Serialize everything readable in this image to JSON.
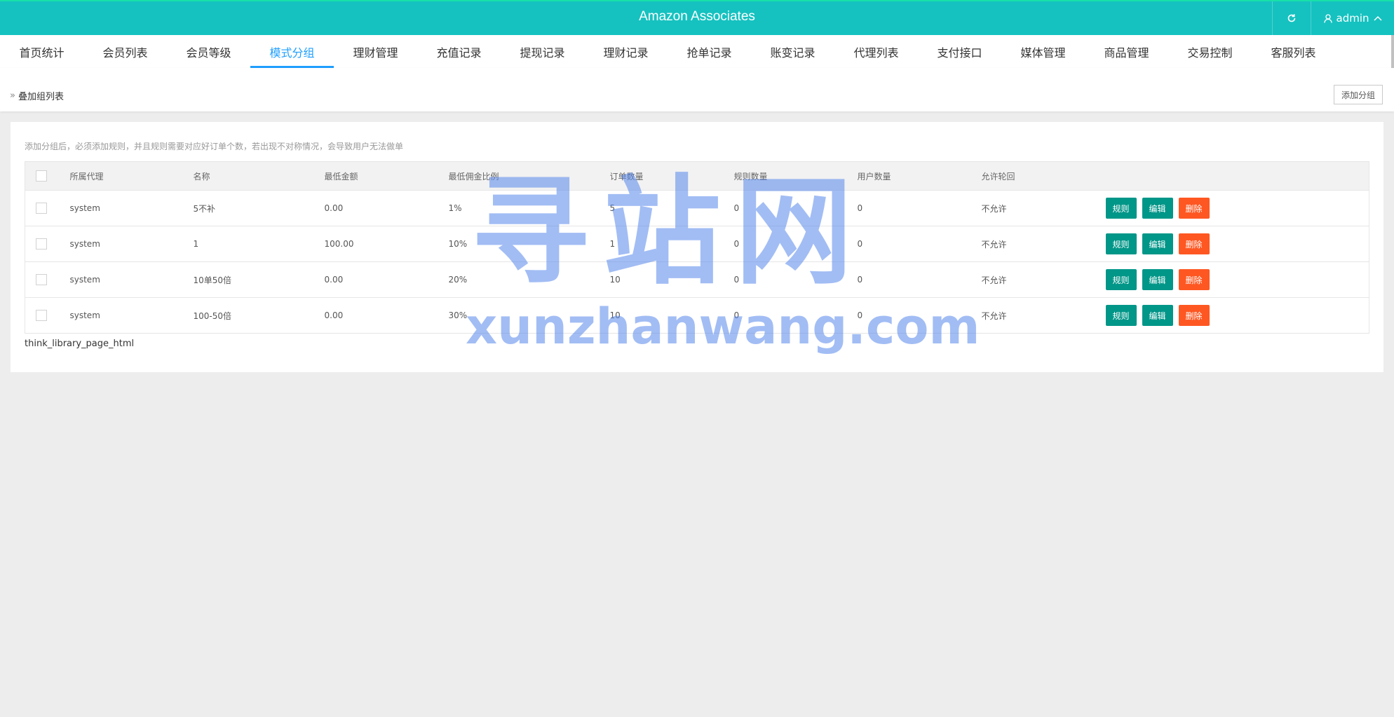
{
  "header": {
    "title": "Amazon Associates",
    "user_label": "admin"
  },
  "nav": {
    "tabs": [
      {
        "label": "首页统计"
      },
      {
        "label": "会员列表"
      },
      {
        "label": "会员等级"
      },
      {
        "label": "模式分组",
        "active": true
      },
      {
        "label": "理财管理"
      },
      {
        "label": "充值记录"
      },
      {
        "label": "提现记录"
      },
      {
        "label": "理财记录"
      },
      {
        "label": "抢单记录"
      },
      {
        "label": "账变记录"
      },
      {
        "label": "代理列表"
      },
      {
        "label": "支付接口"
      },
      {
        "label": "媒体管理"
      },
      {
        "label": "商品管理"
      },
      {
        "label": "交易控制"
      },
      {
        "label": "客服列表"
      }
    ]
  },
  "breadcrumb": {
    "label": "叠加组列表",
    "add_button": "添加分组"
  },
  "content": {
    "notice": "添加分组后，必须添加规则，并且规则需要对应好订单个数，若出现不对称情况，会导致用户无法做单",
    "table": {
      "headers": [
        "所属代理",
        "名称",
        "最低金额",
        "最低佣金比例",
        "订单数量",
        "规则数量",
        "用户数量",
        "允许轮回"
      ],
      "rows": [
        {
          "agent": "system",
          "name": "5不补",
          "min_amount": "0.00",
          "min_ratio": "1%",
          "orders": "5",
          "rules": "0",
          "users": "0",
          "allow": "不允许"
        },
        {
          "agent": "system",
          "name": "1",
          "min_amount": "100.00",
          "min_ratio": "10%",
          "orders": "1",
          "rules": "0",
          "users": "0",
          "allow": "不允许"
        },
        {
          "agent": "system",
          "name": "10单50倍",
          "min_amount": "0.00",
          "min_ratio": "20%",
          "orders": "10",
          "rules": "0",
          "users": "0",
          "allow": "不允许"
        },
        {
          "agent": "system",
          "name": "100-50倍",
          "min_amount": "0.00",
          "min_ratio": "30%",
          "orders": "10",
          "rules": "0",
          "users": "0",
          "allow": "不允许"
        }
      ],
      "actions": {
        "rules": "规则",
        "edit": "编辑",
        "delete": "删除"
      }
    },
    "pager_text": "think_library_page_html"
  },
  "watermark": {
    "cn": "寻站网",
    "en": "xunzhanwang.com"
  },
  "colors": {
    "header_bg": "#15c2c0",
    "accent": "#1e9fff",
    "btn_teal": "#009688",
    "btn_orange": "#ff5722"
  }
}
